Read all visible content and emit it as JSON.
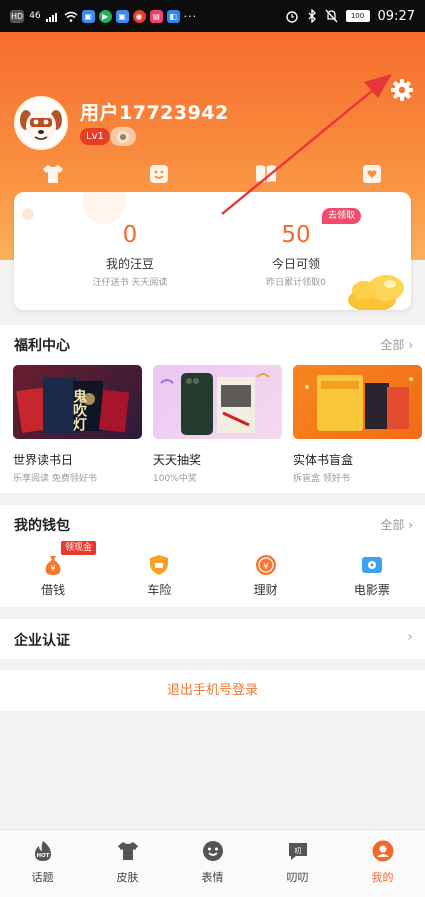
{
  "status_bar": {
    "left_chips": [
      "HD",
      "46",
      "⇅"
    ],
    "time": "09:27",
    "battery": "100"
  },
  "colors": {
    "accent": "#f26a2b",
    "header_gradient_start": "#f66d2e",
    "header_gradient_end": "#fbb05a",
    "annotation_arrow": "#e8353a"
  },
  "profile": {
    "username": "用户17723942",
    "level": "Lv1"
  },
  "quick_nav": [
    {
      "label": "皮肤",
      "icon": "shirt-icon"
    },
    {
      "label": "表情",
      "icon": "smile-box-icon"
    },
    {
      "label": "词库",
      "icon": "book-icon"
    },
    {
      "label": "关注",
      "icon": "heart-box-icon"
    }
  ],
  "beans": {
    "my_beans": {
      "value": "0",
      "title": "我的汪豆",
      "subtitle": "汪仔送书 天天阅读"
    },
    "today": {
      "value": "50",
      "title": "今日可领",
      "subtitle": "昨日累计领取0",
      "tag": "去领取"
    }
  },
  "welfare": {
    "title": "福利中心",
    "more": "全部",
    "cards": [
      {
        "title": "世界读书日",
        "subtitle": "乐享阅读 免费领好书",
        "image_text": "鬼吹灯"
      },
      {
        "title": "天天抽奖",
        "subtitle": "100%中奖",
        "image_text": ""
      },
      {
        "title": "实体书盲盒",
        "subtitle": "拆盲盒 领好书",
        "image_text": ""
      }
    ]
  },
  "wallet": {
    "title": "我的钱包",
    "more": "全部",
    "items": [
      {
        "label": "借钱",
        "icon": "money-bag-icon",
        "tag": "领现金"
      },
      {
        "label": "车险",
        "icon": "shield-icon"
      },
      {
        "label": "理财",
        "icon": "yen-coin-icon"
      },
      {
        "label": "电影票",
        "icon": "ticket-icon"
      }
    ]
  },
  "enterprise": {
    "title": "企业认证"
  },
  "logout": {
    "label": "退出手机号登录"
  },
  "tabbar": [
    {
      "label": "话题",
      "icon": "hot-topic-icon",
      "active": false
    },
    {
      "label": "皮肤",
      "icon": "shirt-icon",
      "active": false
    },
    {
      "label": "表情",
      "icon": "emoji-face-icon",
      "active": false
    },
    {
      "label": "叨叨",
      "icon": "chat-bubble-icon",
      "active": false
    },
    {
      "label": "我的",
      "icon": "profile-icon",
      "active": true
    }
  ]
}
